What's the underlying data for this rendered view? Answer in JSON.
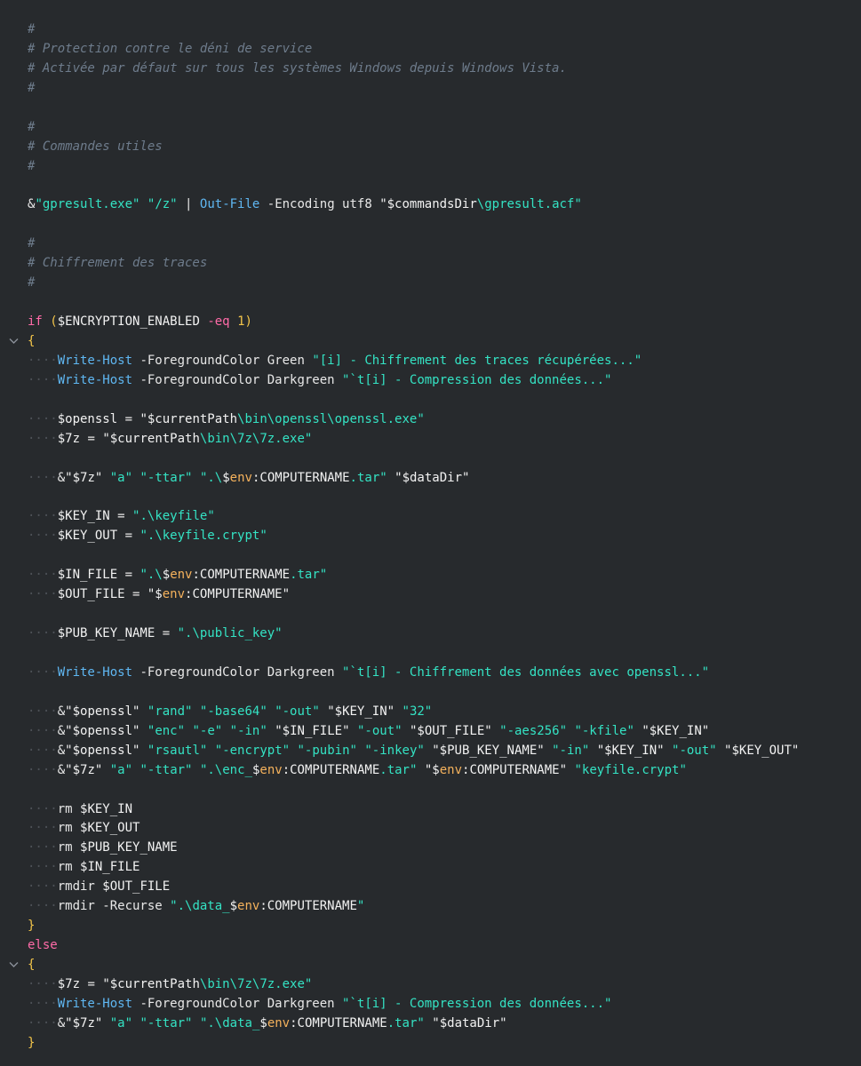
{
  "editor": {
    "lines": [
      {
        "fold": false,
        "tokens": [
          {
            "c": "comment",
            "t": "#"
          }
        ]
      },
      {
        "fold": false,
        "tokens": [
          {
            "c": "comment",
            "t": "# Protection contre le déni de service"
          }
        ]
      },
      {
        "fold": false,
        "tokens": [
          {
            "c": "comment",
            "t": "# Activée par défaut sur tous les systèmes Windows depuis Windows Vista."
          }
        ]
      },
      {
        "fold": false,
        "tokens": [
          {
            "c": "comment",
            "t": "#"
          }
        ]
      },
      {
        "fold": false,
        "tokens": []
      },
      {
        "fold": false,
        "tokens": [
          {
            "c": "comment",
            "t": "#"
          }
        ]
      },
      {
        "fold": false,
        "tokens": [
          {
            "c": "comment",
            "t": "# Commandes utiles"
          }
        ]
      },
      {
        "fold": false,
        "tokens": [
          {
            "c": "comment",
            "t": "#"
          }
        ]
      },
      {
        "fold": false,
        "tokens": []
      },
      {
        "fold": false,
        "tokens": [
          {
            "c": "amp",
            "t": "&"
          },
          {
            "c": "string",
            "t": "\"gpresult.exe\""
          },
          {
            "c": "plain",
            "t": " "
          },
          {
            "c": "string",
            "t": "\"/z\""
          },
          {
            "c": "plain",
            "t": " | "
          },
          {
            "c": "cmdlet",
            "t": "Out-File"
          },
          {
            "c": "plain",
            "t": " -Encoding utf8 "
          },
          {
            "c": "var",
            "t": "\"$commandsDir"
          },
          {
            "c": "string",
            "t": "\\gpresult.acf\""
          }
        ]
      },
      {
        "fold": false,
        "tokens": []
      },
      {
        "fold": false,
        "tokens": [
          {
            "c": "comment",
            "t": "#"
          }
        ]
      },
      {
        "fold": false,
        "tokens": [
          {
            "c": "comment",
            "t": "# Chiffrement des traces"
          }
        ]
      },
      {
        "fold": false,
        "tokens": [
          {
            "c": "comment",
            "t": "#"
          }
        ]
      },
      {
        "fold": false,
        "tokens": []
      },
      {
        "fold": false,
        "tokens": [
          {
            "c": "keyword",
            "t": "if"
          },
          {
            "c": "plain",
            "t": " "
          },
          {
            "c": "paren",
            "t": "("
          },
          {
            "c": "var",
            "t": "$ENCRYPTION_ENABLED"
          },
          {
            "c": "plain",
            "t": " "
          },
          {
            "c": "op",
            "t": "-eq"
          },
          {
            "c": "plain",
            "t": " "
          },
          {
            "c": "num",
            "t": "1"
          },
          {
            "c": "paren",
            "t": ")"
          }
        ]
      },
      {
        "fold": true,
        "tokens": [
          {
            "c": "brace",
            "t": "{"
          }
        ]
      },
      {
        "fold": false,
        "indent": 1,
        "tokens": [
          {
            "c": "cmdlet",
            "t": "Write-Host"
          },
          {
            "c": "plain",
            "t": " -ForegroundColor Green "
          },
          {
            "c": "string",
            "t": "\"[i] - Chiffrement des traces récupérées...\""
          }
        ]
      },
      {
        "fold": false,
        "indent": 1,
        "tokens": [
          {
            "c": "cmdlet",
            "t": "Write-Host"
          },
          {
            "c": "plain",
            "t": " -ForegroundColor Darkgreen "
          },
          {
            "c": "string",
            "t": "\"`t[i] - Compression des données...\""
          }
        ]
      },
      {
        "fold": false,
        "tokens": []
      },
      {
        "fold": false,
        "indent": 1,
        "tokens": [
          {
            "c": "var",
            "t": "$openssl"
          },
          {
            "c": "plain",
            "t": " = "
          },
          {
            "c": "var",
            "t": "\"$currentPath"
          },
          {
            "c": "string",
            "t": "\\bin\\openssl\\openssl.exe\""
          }
        ]
      },
      {
        "fold": false,
        "indent": 1,
        "tokens": [
          {
            "c": "var",
            "t": "$7z"
          },
          {
            "c": "plain",
            "t": " = "
          },
          {
            "c": "var",
            "t": "\"$currentPath"
          },
          {
            "c": "string",
            "t": "\\bin\\7z\\7z.exe\""
          }
        ]
      },
      {
        "fold": false,
        "tokens": []
      },
      {
        "fold": false,
        "indent": 1,
        "tokens": [
          {
            "c": "amp",
            "t": "&"
          },
          {
            "c": "var",
            "t": "\"$7z\""
          },
          {
            "c": "plain",
            "t": " "
          },
          {
            "c": "string",
            "t": "\"a\""
          },
          {
            "c": "plain",
            "t": " "
          },
          {
            "c": "string",
            "t": "\"-ttar\""
          },
          {
            "c": "plain",
            "t": " "
          },
          {
            "c": "string",
            "t": "\".\\"
          },
          {
            "c": "var",
            "t": "$"
          },
          {
            "c": "envscope",
            "t": "env"
          },
          {
            "c": "var",
            "t": ":COMPUTERNAME"
          },
          {
            "c": "string",
            "t": ".tar\""
          },
          {
            "c": "plain",
            "t": " "
          },
          {
            "c": "var",
            "t": "\"$dataDir\""
          }
        ]
      },
      {
        "fold": false,
        "tokens": []
      },
      {
        "fold": false,
        "indent": 1,
        "tokens": [
          {
            "c": "var",
            "t": "$KEY_IN"
          },
          {
            "c": "plain",
            "t": " = "
          },
          {
            "c": "string",
            "t": "\".\\keyfile\""
          }
        ]
      },
      {
        "fold": false,
        "indent": 1,
        "tokens": [
          {
            "c": "var",
            "t": "$KEY_OUT"
          },
          {
            "c": "plain",
            "t": " = "
          },
          {
            "c": "string",
            "t": "\".\\keyfile.crypt\""
          }
        ]
      },
      {
        "fold": false,
        "tokens": []
      },
      {
        "fold": false,
        "indent": 1,
        "tokens": [
          {
            "c": "var",
            "t": "$IN_FILE"
          },
          {
            "c": "plain",
            "t": " = "
          },
          {
            "c": "string",
            "t": "\".\\"
          },
          {
            "c": "var",
            "t": "$"
          },
          {
            "c": "envscope",
            "t": "env"
          },
          {
            "c": "var",
            "t": ":COMPUTERNAME"
          },
          {
            "c": "string",
            "t": ".tar\""
          }
        ]
      },
      {
        "fold": false,
        "indent": 1,
        "tokens": [
          {
            "c": "var",
            "t": "$OUT_FILE"
          },
          {
            "c": "plain",
            "t": " = "
          },
          {
            "c": "var",
            "t": "\"$"
          },
          {
            "c": "envscope",
            "t": "env"
          },
          {
            "c": "var",
            "t": ":COMPUTERNAME\""
          }
        ]
      },
      {
        "fold": false,
        "tokens": []
      },
      {
        "fold": false,
        "indent": 1,
        "tokens": [
          {
            "c": "var",
            "t": "$PUB_KEY_NAME"
          },
          {
            "c": "plain",
            "t": " = "
          },
          {
            "c": "string",
            "t": "\".\\public_key\""
          }
        ]
      },
      {
        "fold": false,
        "tokens": []
      },
      {
        "fold": false,
        "indent": 1,
        "tokens": [
          {
            "c": "cmdlet",
            "t": "Write-Host"
          },
          {
            "c": "plain",
            "t": " -ForegroundColor Darkgreen "
          },
          {
            "c": "string",
            "t": "\"`t[i] - Chiffrement des données avec openssl...\""
          }
        ]
      },
      {
        "fold": false,
        "tokens": []
      },
      {
        "fold": false,
        "indent": 1,
        "tokens": [
          {
            "c": "amp",
            "t": "&"
          },
          {
            "c": "var",
            "t": "\"$openssl\""
          },
          {
            "c": "plain",
            "t": " "
          },
          {
            "c": "string",
            "t": "\"rand\""
          },
          {
            "c": "plain",
            "t": " "
          },
          {
            "c": "string",
            "t": "\"-base64\""
          },
          {
            "c": "plain",
            "t": " "
          },
          {
            "c": "string",
            "t": "\"-out\""
          },
          {
            "c": "plain",
            "t": " "
          },
          {
            "c": "var",
            "t": "\"$KEY_IN\""
          },
          {
            "c": "plain",
            "t": " "
          },
          {
            "c": "string",
            "t": "\"32\""
          }
        ]
      },
      {
        "fold": false,
        "indent": 1,
        "tokens": [
          {
            "c": "amp",
            "t": "&"
          },
          {
            "c": "var",
            "t": "\"$openssl\""
          },
          {
            "c": "plain",
            "t": " "
          },
          {
            "c": "string",
            "t": "\"enc\""
          },
          {
            "c": "plain",
            "t": " "
          },
          {
            "c": "string",
            "t": "\"-e\""
          },
          {
            "c": "plain",
            "t": " "
          },
          {
            "c": "string",
            "t": "\"-in\""
          },
          {
            "c": "plain",
            "t": " "
          },
          {
            "c": "var",
            "t": "\"$IN_FILE\""
          },
          {
            "c": "plain",
            "t": " "
          },
          {
            "c": "string",
            "t": "\"-out\""
          },
          {
            "c": "plain",
            "t": " "
          },
          {
            "c": "var",
            "t": "\"$OUT_FILE\""
          },
          {
            "c": "plain",
            "t": " "
          },
          {
            "c": "string",
            "t": "\"-aes256\""
          },
          {
            "c": "plain",
            "t": " "
          },
          {
            "c": "string",
            "t": "\"-kfile\""
          },
          {
            "c": "plain",
            "t": " "
          },
          {
            "c": "var",
            "t": "\"$KEY_IN\""
          }
        ]
      },
      {
        "fold": false,
        "indent": 1,
        "tokens": [
          {
            "c": "amp",
            "t": "&"
          },
          {
            "c": "var",
            "t": "\"$openssl\""
          },
          {
            "c": "plain",
            "t": " "
          },
          {
            "c": "string",
            "t": "\"rsautl\""
          },
          {
            "c": "plain",
            "t": " "
          },
          {
            "c": "string",
            "t": "\"-encrypt\""
          },
          {
            "c": "plain",
            "t": " "
          },
          {
            "c": "string",
            "t": "\"-pubin\""
          },
          {
            "c": "plain",
            "t": " "
          },
          {
            "c": "string",
            "t": "\"-inkey\""
          },
          {
            "c": "plain",
            "t": " "
          },
          {
            "c": "var",
            "t": "\"$PUB_KEY_NAME\""
          },
          {
            "c": "plain",
            "t": " "
          },
          {
            "c": "string",
            "t": "\"-in\""
          },
          {
            "c": "plain",
            "t": " "
          },
          {
            "c": "var",
            "t": "\"$KEY_IN\""
          },
          {
            "c": "plain",
            "t": " "
          },
          {
            "c": "string",
            "t": "\"-out\""
          },
          {
            "c": "plain",
            "t": " "
          },
          {
            "c": "var",
            "t": "\"$KEY_OUT\""
          }
        ]
      },
      {
        "fold": false,
        "indent": 1,
        "tokens": [
          {
            "c": "amp",
            "t": "&"
          },
          {
            "c": "var",
            "t": "\"$7z\""
          },
          {
            "c": "plain",
            "t": " "
          },
          {
            "c": "string",
            "t": "\"a\""
          },
          {
            "c": "plain",
            "t": " "
          },
          {
            "c": "string",
            "t": "\"-ttar\""
          },
          {
            "c": "plain",
            "t": " "
          },
          {
            "c": "string",
            "t": "\".\\enc_"
          },
          {
            "c": "var",
            "t": "$"
          },
          {
            "c": "envscope",
            "t": "env"
          },
          {
            "c": "var",
            "t": ":COMPUTERNAME"
          },
          {
            "c": "string",
            "t": ".tar\""
          },
          {
            "c": "plain",
            "t": " "
          },
          {
            "c": "var",
            "t": "\"$"
          },
          {
            "c": "envscope",
            "t": "env"
          },
          {
            "c": "var",
            "t": ":COMPUTERNAME\""
          },
          {
            "c": "plain",
            "t": " "
          },
          {
            "c": "string",
            "t": "\"keyfile.crypt\""
          }
        ]
      },
      {
        "fold": false,
        "tokens": []
      },
      {
        "fold": false,
        "indent": 1,
        "tokens": [
          {
            "c": "plain",
            "t": "rm "
          },
          {
            "c": "var",
            "t": "$KEY_IN"
          }
        ]
      },
      {
        "fold": false,
        "indent": 1,
        "tokens": [
          {
            "c": "plain",
            "t": "rm "
          },
          {
            "c": "var",
            "t": "$KEY_OUT"
          }
        ]
      },
      {
        "fold": false,
        "indent": 1,
        "tokens": [
          {
            "c": "plain",
            "t": "rm "
          },
          {
            "c": "var",
            "t": "$PUB_KEY_NAME"
          }
        ]
      },
      {
        "fold": false,
        "indent": 1,
        "tokens": [
          {
            "c": "plain",
            "t": "rm "
          },
          {
            "c": "var",
            "t": "$IN_FILE"
          }
        ]
      },
      {
        "fold": false,
        "indent": 1,
        "tokens": [
          {
            "c": "plain",
            "t": "rmdir "
          },
          {
            "c": "var",
            "t": "$OUT_FILE"
          }
        ]
      },
      {
        "fold": false,
        "indent": 1,
        "tokens": [
          {
            "c": "plain",
            "t": "rmdir -Recurse "
          },
          {
            "c": "string",
            "t": "\".\\data_"
          },
          {
            "c": "var",
            "t": "$"
          },
          {
            "c": "envscope",
            "t": "env"
          },
          {
            "c": "var",
            "t": ":COMPUTERNAME"
          },
          {
            "c": "string",
            "t": "\""
          }
        ]
      },
      {
        "fold": false,
        "tokens": [
          {
            "c": "brace",
            "t": "}"
          }
        ]
      },
      {
        "fold": false,
        "tokens": [
          {
            "c": "keyword",
            "t": "else"
          }
        ]
      },
      {
        "fold": true,
        "tokens": [
          {
            "c": "brace",
            "t": "{"
          }
        ]
      },
      {
        "fold": false,
        "indent": 1,
        "tokens": [
          {
            "c": "var",
            "t": "$7z"
          },
          {
            "c": "plain",
            "t": " = "
          },
          {
            "c": "var",
            "t": "\"$currentPath"
          },
          {
            "c": "string",
            "t": "\\bin\\7z\\7z.exe\""
          }
        ]
      },
      {
        "fold": false,
        "indent": 1,
        "tokens": [
          {
            "c": "cmdlet",
            "t": "Write-Host"
          },
          {
            "c": "plain",
            "t": " -ForegroundColor Darkgreen "
          },
          {
            "c": "string",
            "t": "\"`t[i] - Compression des données...\""
          }
        ]
      },
      {
        "fold": false,
        "indent": 1,
        "tokens": [
          {
            "c": "amp",
            "t": "&"
          },
          {
            "c": "var",
            "t": "\"$7z\""
          },
          {
            "c": "plain",
            "t": " "
          },
          {
            "c": "string",
            "t": "\"a\""
          },
          {
            "c": "plain",
            "t": " "
          },
          {
            "c": "string",
            "t": "\"-ttar\""
          },
          {
            "c": "plain",
            "t": " "
          },
          {
            "c": "string",
            "t": "\".\\data_"
          },
          {
            "c": "var",
            "t": "$"
          },
          {
            "c": "envscope",
            "t": "env"
          },
          {
            "c": "var",
            "t": ":COMPUTERNAME"
          },
          {
            "c": "string",
            "t": ".tar\""
          },
          {
            "c": "plain",
            "t": " "
          },
          {
            "c": "var",
            "t": "\"$dataDir\""
          }
        ]
      },
      {
        "fold": false,
        "tokens": [
          {
            "c": "brace",
            "t": "}"
          }
        ]
      }
    ]
  },
  "theme": {
    "background": "#272a2d",
    "comment": "#6e7c8c",
    "keyword": "#ff6ba8",
    "cmdlet": "#5fb7f2",
    "string": "#34e3c4",
    "brace": "#f3c54a"
  },
  "icons": {
    "fold": "chevron-down-icon"
  }
}
